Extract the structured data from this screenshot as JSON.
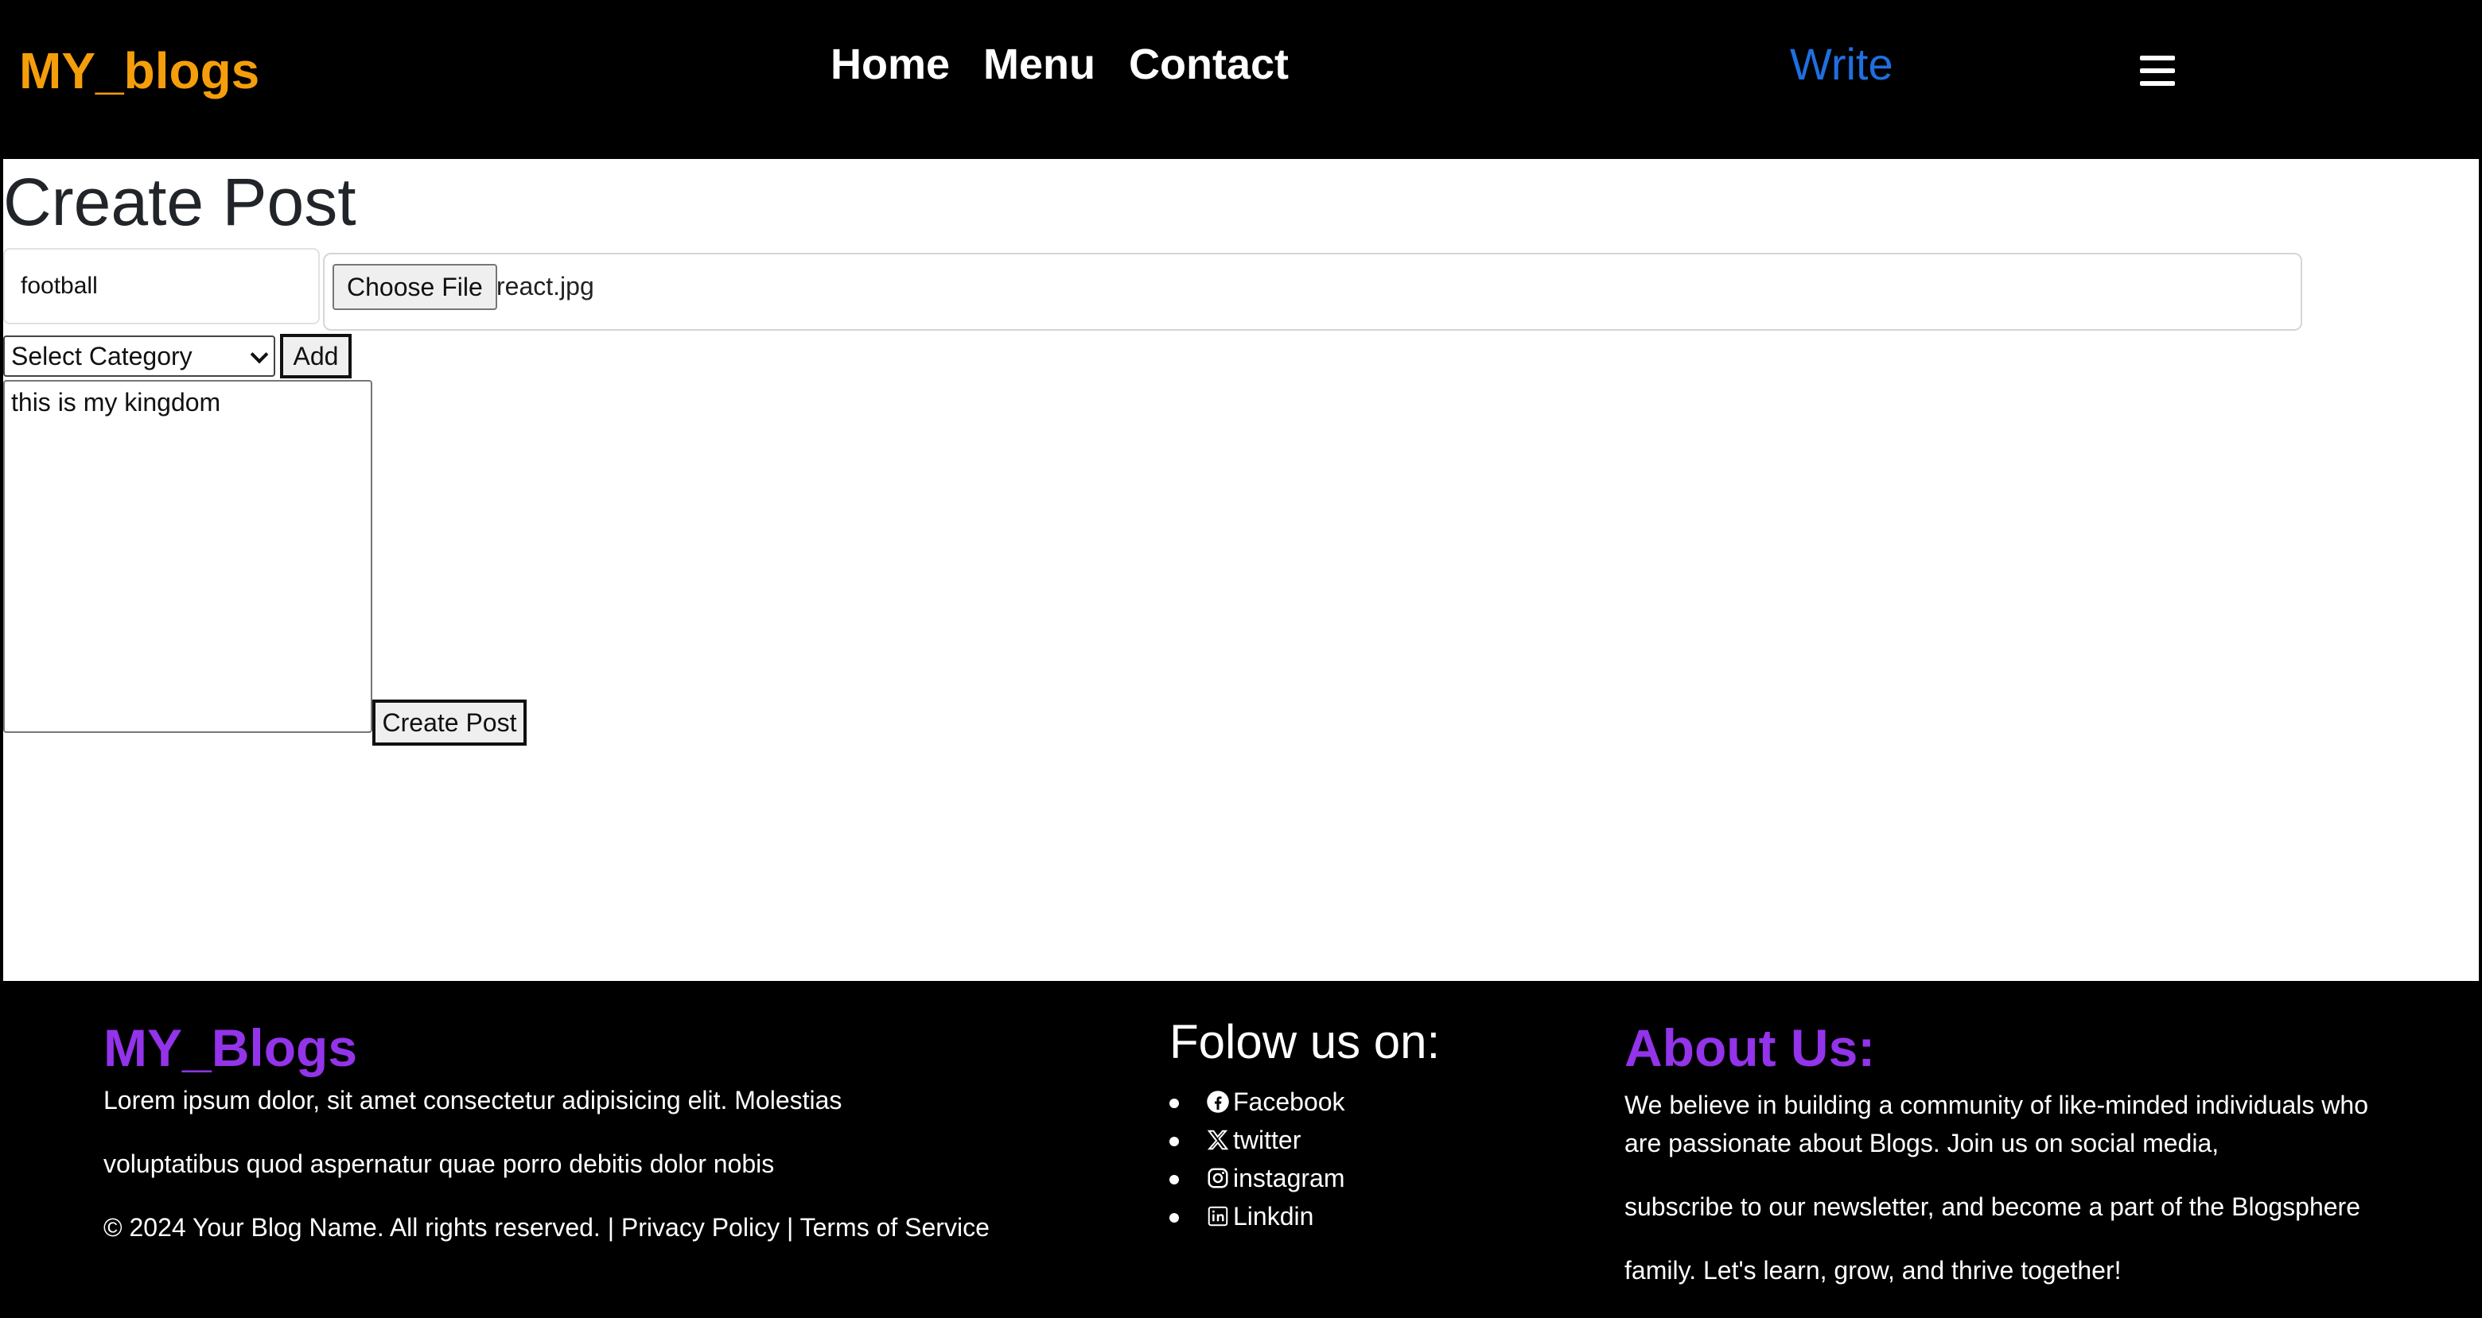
{
  "navbar": {
    "brand": "MY_blogs",
    "links": [
      "Home",
      "Menu",
      "Contact"
    ],
    "write": "Write",
    "menu_icon": "hamburger-icon"
  },
  "form": {
    "heading": "Create Post",
    "title_value": "football",
    "file_button": "Choose File",
    "file_name": "react.jpg",
    "category_selected": "Select Category",
    "add_label": "Add",
    "body_value": "this is my kingdom",
    "submit_label": "Create Post"
  },
  "footer": {
    "brand": "MY_Blogs",
    "lines": [
      "Lorem ipsum dolor, sit amet consectetur adipisicing elit. Molestias",
      "voluptatibus quod aspernatur quae porro debitis dolor nobis"
    ],
    "copyright": "© 2024 Your Blog Name. All rights reserved. |",
    "privacy": "Privacy Policy",
    "separator": "|",
    "terms": "Terms of Service",
    "follow_title": "Folow us on:",
    "social": [
      {
        "label": "Facebook",
        "icon": "facebook-icon"
      },
      {
        "label": "twitter",
        "icon": "x-twitter-icon"
      },
      {
        "label": " instagram",
        "icon": "instagram-icon"
      },
      {
        "label": "Linkdin",
        "icon": "linkedin-icon"
      }
    ],
    "about_title": "About Us:",
    "about_lines": [
      "We believe in building a community of like-minded individuals who are passionate about Blogs. Join us on social media,",
      "subscribe to our newsletter, and become a part of the Blogsphere",
      "family. Let's learn, grow, and thrive together!"
    ]
  },
  "colors": {
    "brand_orange": "#f59e0b",
    "write_blue": "#1f6fe0",
    "footer_purple": "#9333ea",
    "background": "#000000"
  }
}
